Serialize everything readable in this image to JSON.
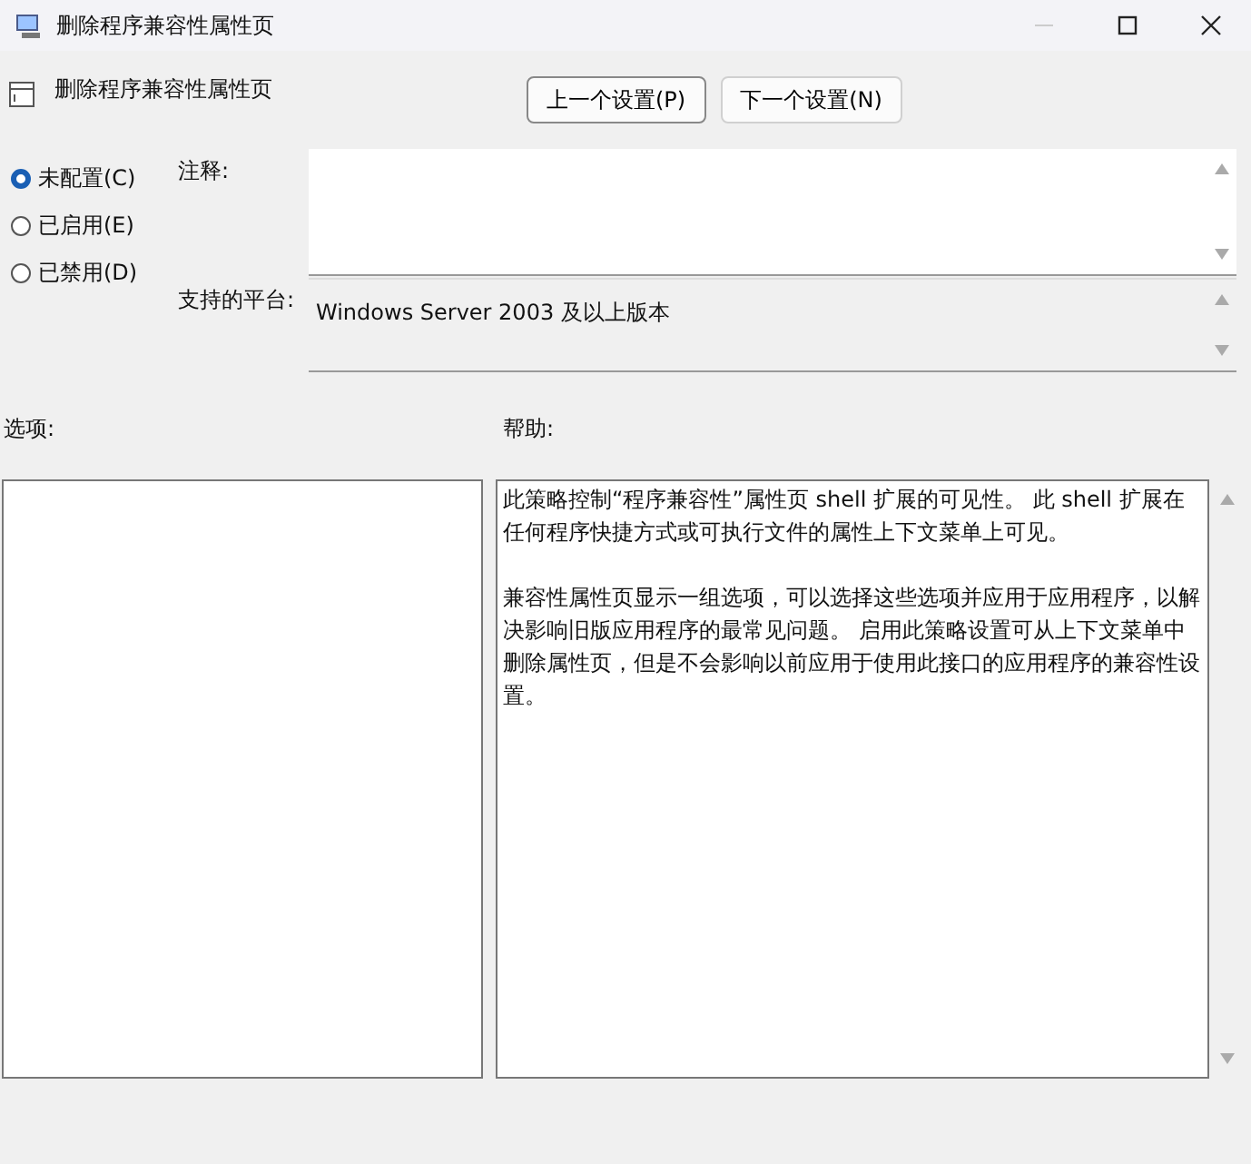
{
  "window": {
    "title": "删除程序兼容性属性页"
  },
  "header": {
    "title": "删除程序兼容性属性页",
    "buttons": [
      "上一个设置(P)",
      "下一个设置(N)"
    ]
  },
  "states": [
    {
      "label": "未配置(C)",
      "selected": true
    },
    {
      "label": "已启用(E)",
      "selected": false
    },
    {
      "label": "已禁用(D)",
      "selected": false
    }
  ],
  "comment": {
    "label": "注释:"
  },
  "platform": {
    "label": "支持的平台:",
    "value": "Windows Server 2003 及以上版本"
  },
  "options": {
    "label": "选项:"
  },
  "help": {
    "label": "帮助:",
    "paragraphs": [
      "此策略控制“程序兼容性”属性页 shell 扩展的可见性。 此 shell 扩展在任何程序快捷方式或可执行文件的属性上下文菜单上可见。",
      "兼容性属性页显示一组选项，可以选择这些选项并应用于应用程序，以解决影响旧版应用程序的最常见问题。 启用此策略设置可从上下文菜单中删除属性页，但是不会影响以前应用于使用此接口的应用程序的兼容性设置。"
    ]
  }
}
